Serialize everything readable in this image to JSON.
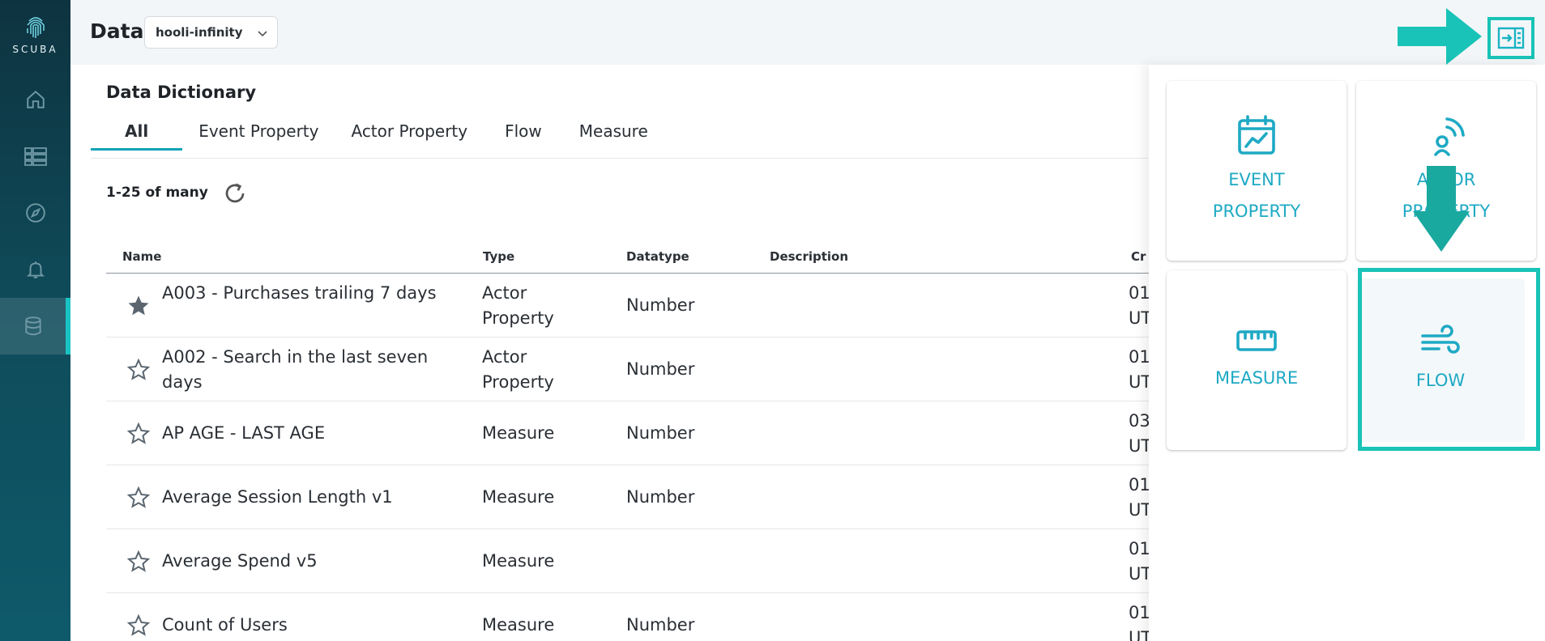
{
  "app": {
    "logo_text": "SCUBA"
  },
  "sidebar": {
    "items": [
      {
        "name": "home"
      },
      {
        "name": "boards"
      },
      {
        "name": "explore"
      },
      {
        "name": "alerts"
      },
      {
        "name": "data",
        "active": true
      }
    ]
  },
  "header": {
    "title": "Data",
    "dataset": "hooli-infinity"
  },
  "main": {
    "section_title": "Data Dictionary",
    "tabs": [
      "All",
      "Event Property",
      "Actor Property",
      "Flow",
      "Measure"
    ],
    "active_tab": "All",
    "result_count": "1-25 of many",
    "columns": [
      "Name",
      "Type",
      "Datatype",
      "Description",
      "Cr"
    ],
    "rows": [
      {
        "name": "A003 - Purchases trailing 7 days",
        "type": "Actor Property",
        "datatype": "Number",
        "created": "01\nUT",
        "starred": true
      },
      {
        "name": "A002 - Search in the last seven days",
        "type": "Actor Property",
        "datatype": "Number",
        "created": "01\nUT",
        "starred": false
      },
      {
        "name": "AP AGE - LAST AGE",
        "type": "Measure",
        "datatype": "Number",
        "created": "03\nUT",
        "starred": false
      },
      {
        "name": "Average Session Length v1",
        "type": "Measure",
        "datatype": "Number",
        "created": "01\nUT",
        "starred": false
      },
      {
        "name": "Average Spend v5",
        "type": "Measure",
        "datatype": "",
        "created": "01\nUT",
        "starred": false
      },
      {
        "name": "Count of Users",
        "type": "Measure",
        "datatype": "Number",
        "created": "01\nUT",
        "starred": false
      }
    ]
  },
  "panel": {
    "cards": [
      {
        "label": "EVENT PROPERTY",
        "icon": "calendar-chart-icon"
      },
      {
        "label": "ACTOR PROPERTY",
        "icon": "actor-broadcast-icon"
      },
      {
        "label": "MEASURE",
        "icon": "ruler-icon"
      },
      {
        "label": "FLOW",
        "icon": "wind-icon"
      }
    ]
  },
  "colors": {
    "accent": "#1ea9c4",
    "highlight": "#19c3b7",
    "sidebar": "#0e3f4d"
  }
}
